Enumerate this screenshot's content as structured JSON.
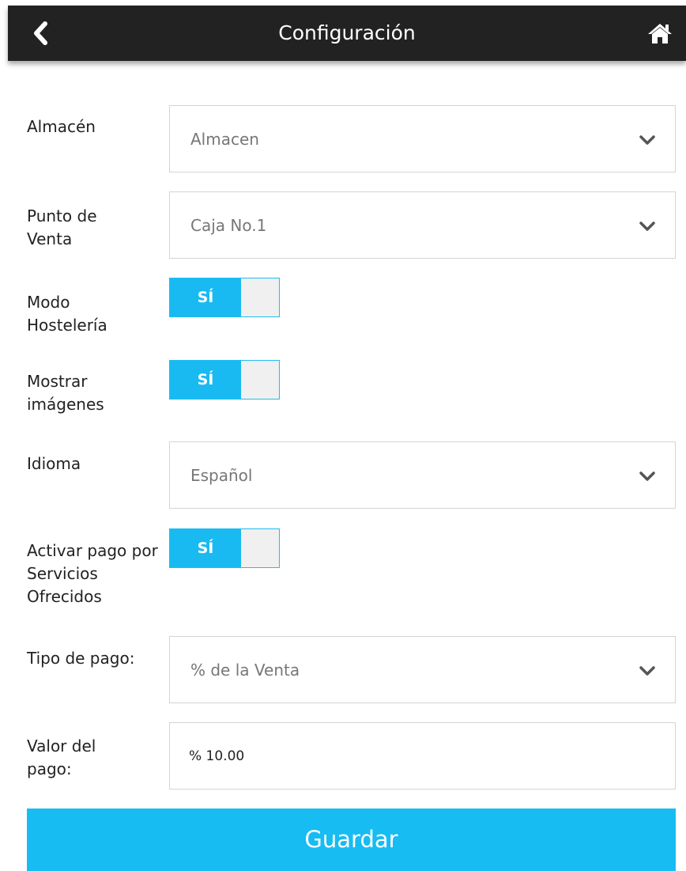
{
  "header": {
    "title": "Configuración",
    "back_icon": "chevron-left-icon",
    "home_icon": "home-icon",
    "bg_color": "#222222"
  },
  "form": {
    "almacen": {
      "label": "Almacén",
      "value": "Almacen"
    },
    "punto_venta": {
      "label": "Punto de Venta",
      "value": "Caja No.1"
    },
    "modo_hosteleria": {
      "label": "Modo Hostelería",
      "toggle_text": "SÍ",
      "enabled": true
    },
    "mostrar_imagenes": {
      "label": "Mostrar imágenes",
      "toggle_text": "SÍ",
      "enabled": true
    },
    "idioma": {
      "label": "Idioma",
      "value": "Español"
    },
    "activar_pago": {
      "label": "Activar pago por Servicios Ofrecidos",
      "toggle_text": "SÍ",
      "enabled": true
    },
    "tipo_pago": {
      "label": "Tipo de pago:",
      "value": "% de la Venta"
    },
    "valor_pago": {
      "label": "Valor del pago:",
      "value": "% 10.00"
    }
  },
  "save_button": {
    "label": "Guardar"
  },
  "colors": {
    "accent": "#19baf2",
    "header": "#222222"
  }
}
